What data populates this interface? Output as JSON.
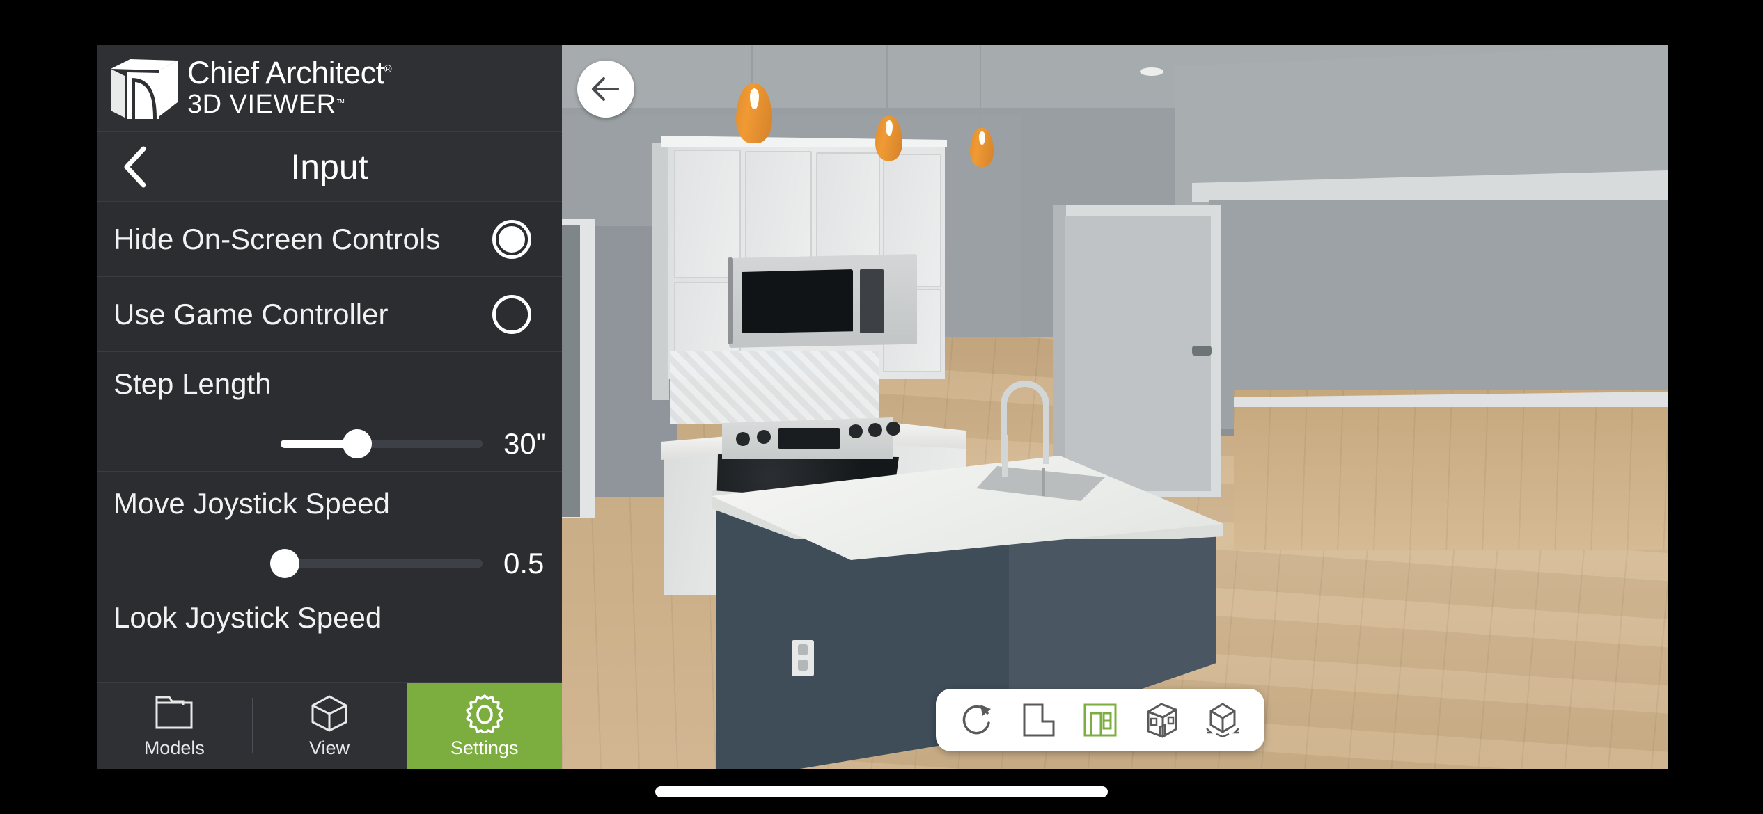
{
  "brand": {
    "line1": "Chief Architect",
    "registered": "®",
    "line2": "3D VIEWER",
    "trademark": "™",
    "logo_icon": "chief-architect-cube-logo"
  },
  "titlebar": {
    "title": "Input",
    "back_icon": "chevron-left-icon"
  },
  "settings": {
    "rows": [
      {
        "label": "Hide On-Screen Controls",
        "type": "radio",
        "selected": true
      },
      {
        "label": "Use Game Controller",
        "type": "radio",
        "selected": false
      },
      {
        "label": "Step Length",
        "type": "slider",
        "value": "30\"",
        "fill_percent": 38
      },
      {
        "label": "Move Joystick Speed",
        "type": "slider",
        "value": "0.5",
        "fill_percent": 2
      },
      {
        "label": "Look Joystick Speed",
        "type": "partial"
      }
    ]
  },
  "tabbar": {
    "tabs": [
      {
        "label": "Models",
        "icon": "folder-icon",
        "active": false
      },
      {
        "label": "View",
        "icon": "cube-icon",
        "active": false
      },
      {
        "label": "Settings",
        "icon": "gear-icon",
        "active": true
      }
    ],
    "active_color": "#7cad3f"
  },
  "viewport": {
    "back_button_icon": "arrow-left-icon",
    "tools": [
      {
        "icon": "reset-rotate-icon",
        "label": "Reset View",
        "active": false
      },
      {
        "icon": "floor-plan-icon",
        "label": "Floor Plan View",
        "active": false
      },
      {
        "icon": "interior-walkthrough-icon",
        "label": "Interior Walkthrough",
        "active": true
      },
      {
        "icon": "doll-house-icon",
        "label": "Doll House View",
        "active": false
      },
      {
        "icon": "overview-orbit-icon",
        "label": "Overview",
        "active": false
      }
    ],
    "active_tool_color": "#7cad3f",
    "scene": {
      "description": "3D rendered kitchen interior walkthrough",
      "wall_color": "#989ea2",
      "ceiling_color": "#a6abae",
      "floor_color": "#d2b692",
      "cabinet_color": "#e6e8e8",
      "island_color": "#3f4d59",
      "countertop_color": "#f2f3f1",
      "pendant_color": "#e8922f",
      "appliance_color": "#151819",
      "pendants": 3
    }
  },
  "system": {
    "home_indicator": true
  }
}
